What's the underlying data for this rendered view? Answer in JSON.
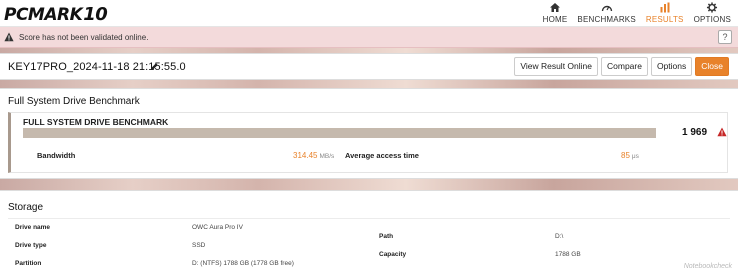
{
  "app": {
    "logo_text": "PCMARK",
    "logo_version": "10"
  },
  "nav": {
    "items": [
      {
        "label": "HOME",
        "icon": "home-icon",
        "active": false
      },
      {
        "label": "BENCHMARKS",
        "icon": "gauge-icon",
        "active": false
      },
      {
        "label": "RESULTS",
        "icon": "bar-chart-icon",
        "active": true
      },
      {
        "label": "OPTIONS",
        "icon": "gear-icon",
        "active": false
      }
    ]
  },
  "warning": {
    "text": "Score has not been validated online.",
    "help": "?"
  },
  "result": {
    "name": "KEY17PRO_2024-11-18 21:15:55.0",
    "buttons": {
      "view_online": "View Result Online",
      "compare": "Compare",
      "options": "Options",
      "close": "Close"
    }
  },
  "benchmark": {
    "section_title": "Full System Drive Benchmark",
    "name": "FULL SYSTEM DRIVE BENCHMARK",
    "score": "1 969",
    "score_bar_fraction": 1.0,
    "bandwidth_label": "Bandwidth",
    "bandwidth_value": "314.45",
    "bandwidth_unit": "MB/s",
    "access_label": "Average access time",
    "access_value": "85",
    "access_unit": "μs"
  },
  "storage": {
    "section_title": "Storage",
    "drive_name_label": "Drive name",
    "drive_name_value": "OWC Aura Pro IV",
    "drive_type_label": "Drive type",
    "drive_type_value": "SSD",
    "partition_label": "Partition",
    "partition_value": "D: (NTFS) 1788 GB (1778 GB free)",
    "path_label": "Path",
    "path_value": "D:\\",
    "capacity_label": "Capacity",
    "capacity_value": "1788 GB"
  },
  "watermark": "Notebookcheck",
  "colors": {
    "accent": "#e8822a",
    "warning_bg": "#f3dadb",
    "bar_fill": "#c5b9ad"
  }
}
